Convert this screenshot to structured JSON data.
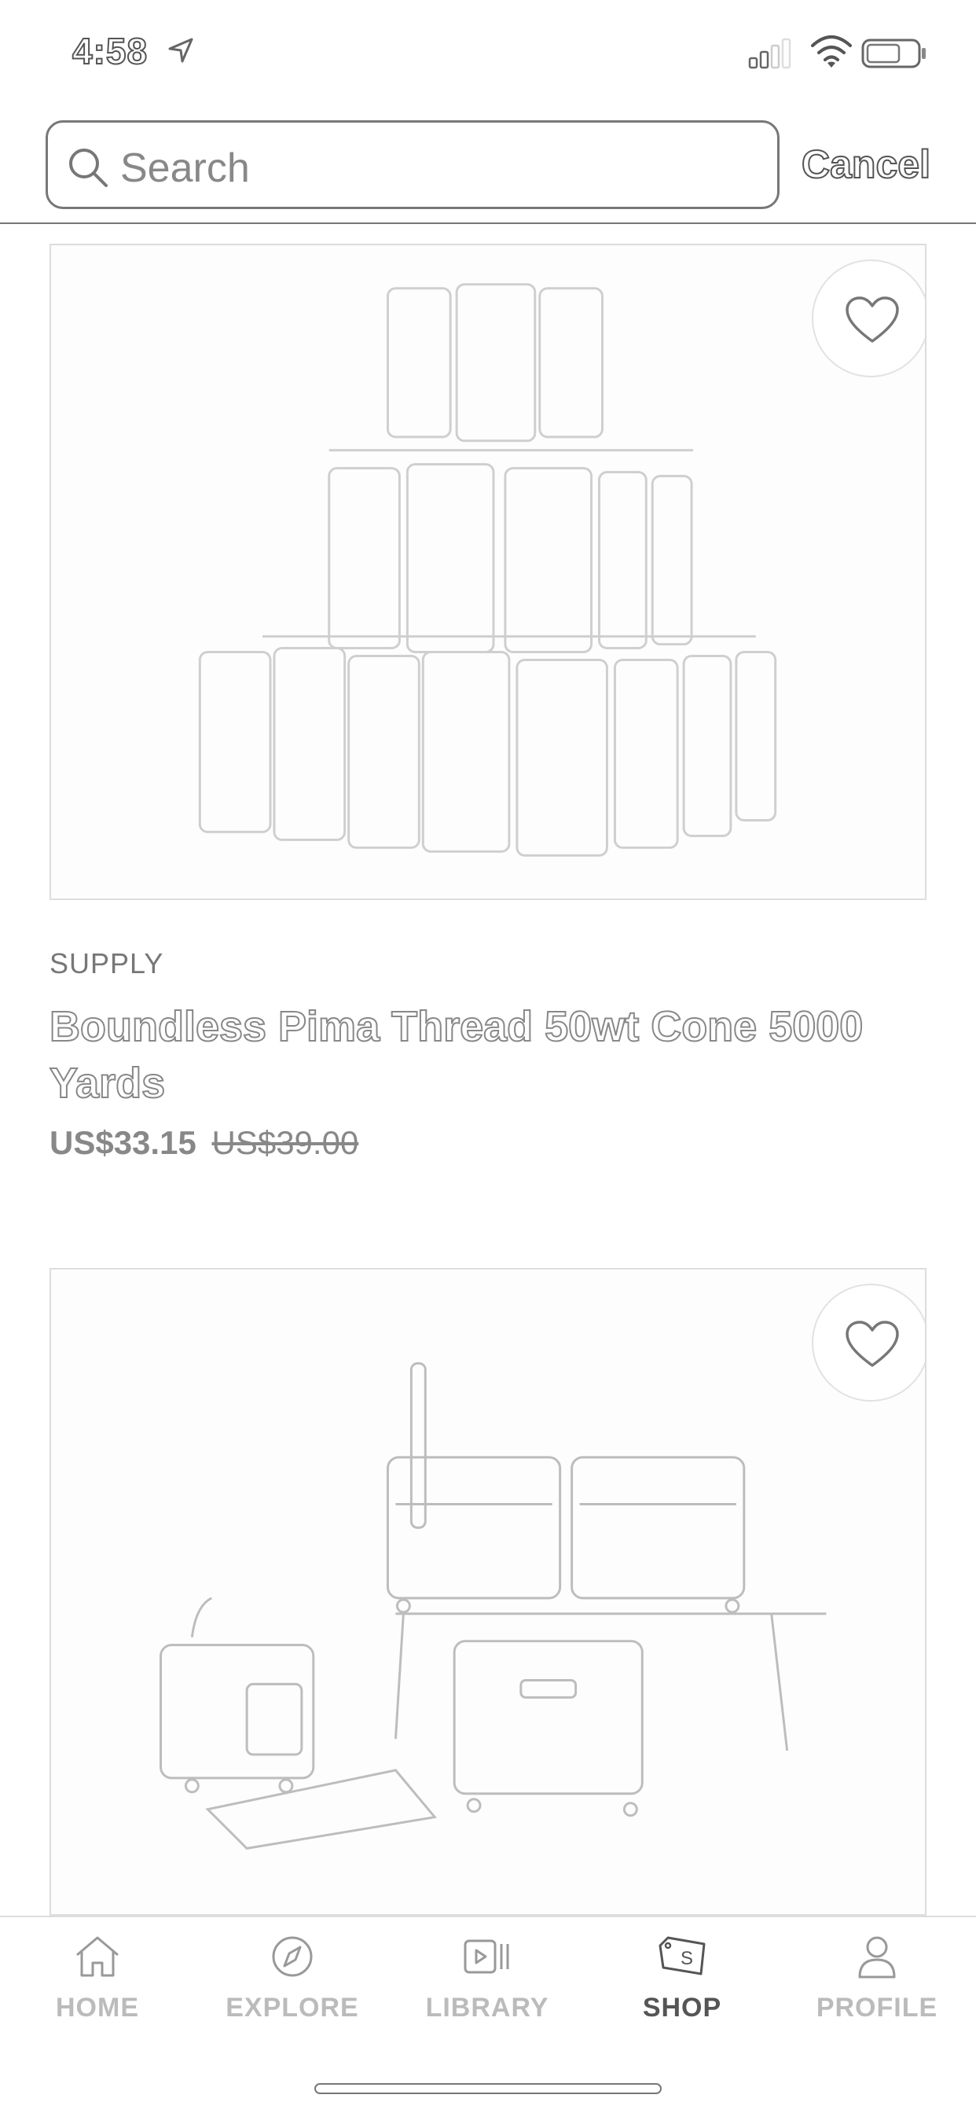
{
  "status_bar": {
    "time": "4:58"
  },
  "search": {
    "placeholder": "Search",
    "cancel_label": "Cancel"
  },
  "products": [
    {
      "category": "SUPPLY",
      "title": "Boundless Pima Thread 50wt Cone 5000 Yards",
      "price": "US$33.15",
      "original_price": "US$39.00",
      "image_icon": "thread-cones-image"
    },
    {
      "image_icon": "luggage-cases-image"
    }
  ],
  "tab_bar": {
    "items": [
      {
        "label": "HOME",
        "icon": "home-icon"
      },
      {
        "label": "EXPLORE",
        "icon": "compass-icon"
      },
      {
        "label": "LIBRARY",
        "icon": "video-library-icon"
      },
      {
        "label": "SHOP",
        "icon": "tag-icon"
      },
      {
        "label": "PROFILE",
        "icon": "person-icon"
      }
    ],
    "active": "SHOP"
  }
}
